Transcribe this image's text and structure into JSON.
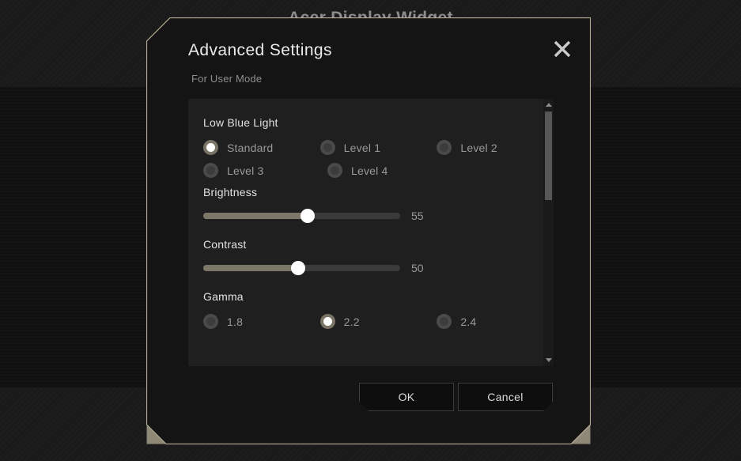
{
  "app": {
    "title": "Acer Display Widget"
  },
  "dialog": {
    "title": "Advanced Settings",
    "subtitle": "For User Mode",
    "close_icon": "close-icon"
  },
  "settings": {
    "low_blue_light": {
      "label": "Low Blue Light",
      "selected": "Standard",
      "options": [
        {
          "label": "Standard",
          "selected": true
        },
        {
          "label": "Level 1",
          "selected": false
        },
        {
          "label": "Level 2",
          "selected": false
        },
        {
          "label": "Level 3",
          "selected": false
        },
        {
          "label": "Level 4",
          "selected": false
        }
      ]
    },
    "brightness": {
      "label": "Brightness",
      "value": "55",
      "percent": 53,
      "min": 0,
      "max": 100
    },
    "contrast": {
      "label": "Contrast",
      "value": "50",
      "percent": 48,
      "min": 0,
      "max": 100
    },
    "gamma": {
      "label": "Gamma",
      "selected": "2.2",
      "options": [
        {
          "label": "1.8",
          "selected": false
        },
        {
          "label": "2.2",
          "selected": true
        },
        {
          "label": "2.4",
          "selected": false
        }
      ]
    }
  },
  "scrollbar": {
    "up_icon": "chevron-up-icon",
    "down_icon": "chevron-down-icon"
  },
  "footer": {
    "ok_label": "OK",
    "cancel_label": "Cancel"
  },
  "colors": {
    "accent": "#b5ad97",
    "slider_fill": "#7d776a",
    "radio_selected": "#7a7466",
    "dialog_bg": "#141414",
    "panel_bg": "#1f1f1f"
  }
}
